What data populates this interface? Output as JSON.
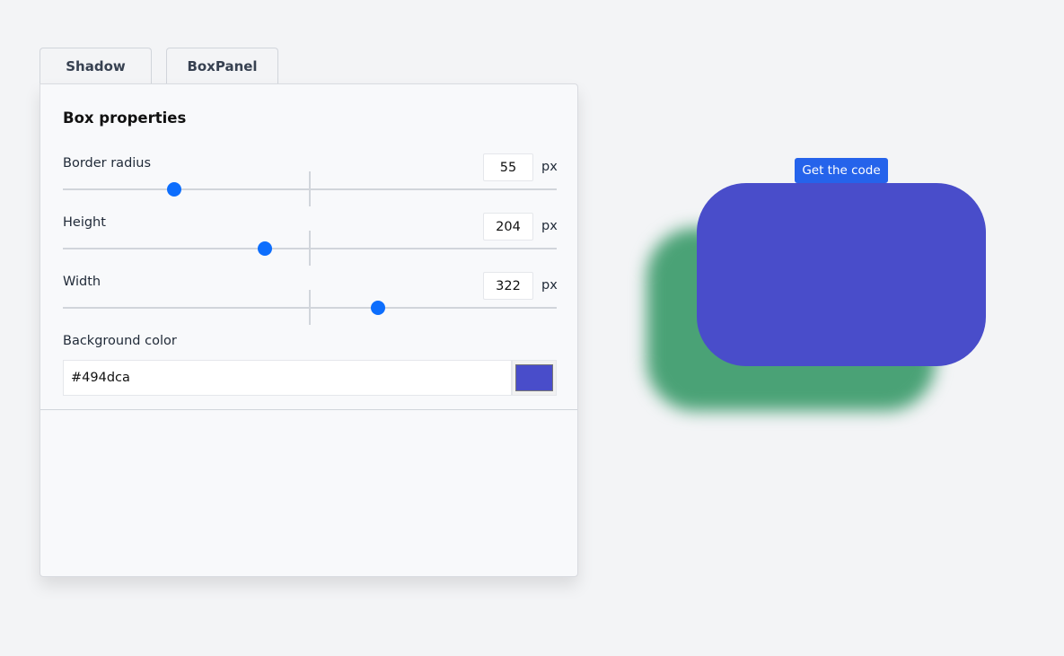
{
  "tabs": [
    {
      "label": "Shadow"
    },
    {
      "label": "BoxPanel"
    }
  ],
  "panel": {
    "title": "Box properties",
    "properties": [
      {
        "label": "Border radius",
        "value": "55",
        "unit": "px",
        "slider_fraction": 0.227
      },
      {
        "label": "Height",
        "value": "204",
        "unit": "px",
        "slider_fraction": 0.41
      },
      {
        "label": "Width",
        "value": "322",
        "unit": "px",
        "slider_fraction": 0.64
      }
    ],
    "background": {
      "label": "Background color",
      "value": "#494dca"
    }
  },
  "preview": {
    "button_label": "Get the code",
    "box_color": "#494dca",
    "shadow_color": "#4aa276"
  }
}
